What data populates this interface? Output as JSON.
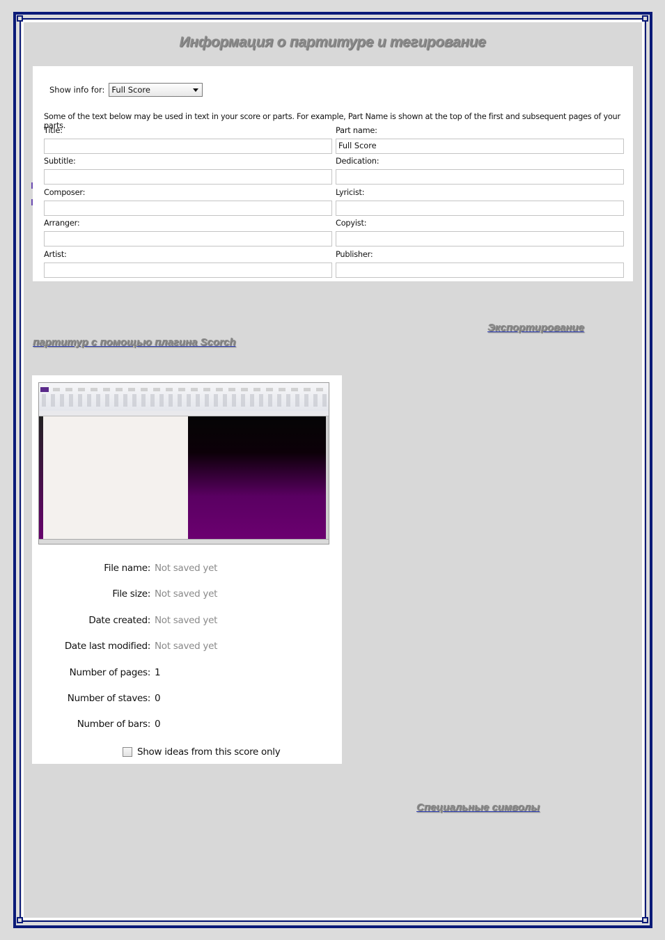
{
  "heading": "Информация о партитуре и тегирование",
  "score_info": {
    "show_info_label": "Show info for:",
    "show_info_value": "Full Score",
    "note": "Some of the text below may be used in text in your score or parts. For example, Part Name is shown at the top of the first and subsequent pages of your parts.",
    "fields": [
      {
        "label": "Title:",
        "value": ""
      },
      {
        "label": "Part name:",
        "value": "Full Score"
      },
      {
        "label": "Subtitle:",
        "value": ""
      },
      {
        "label": "Dedication:",
        "value": ""
      },
      {
        "label": "Composer:",
        "value": ""
      },
      {
        "label": "Lyricist:",
        "value": ""
      },
      {
        "label": "Arranger:",
        "value": ""
      },
      {
        "label": "Copyist:",
        "value": ""
      },
      {
        "label": "Artist:",
        "value": ""
      },
      {
        "label": "Publisher:",
        "value": ""
      }
    ]
  },
  "links": {
    "export_line1": "Экспортирование",
    "export_line2": "партитур с помощью плагина Scorch",
    "special_symbols": "Специальные символы"
  },
  "file_info": {
    "rows": [
      {
        "label": "File name:",
        "value": "Not saved yet"
      },
      {
        "label": "File size:",
        "value": "Not saved yet"
      },
      {
        "label": "Date created:",
        "value": "Not saved yet"
      },
      {
        "label": "Date last modified:",
        "value": "Not saved yet"
      },
      {
        "label": "Number of pages:",
        "value": "1"
      },
      {
        "label": "Number of staves:",
        "value": "0"
      },
      {
        "label": "Number of bars:",
        "value": "0"
      }
    ],
    "checkbox_label": "Show ideas from this score only",
    "checkbox_checked": false
  },
  "colors": {
    "border": "#0a1a78",
    "background": "#d8d8d8",
    "heading": "#8a8a8a",
    "link_underline": "#2b3bb5"
  }
}
